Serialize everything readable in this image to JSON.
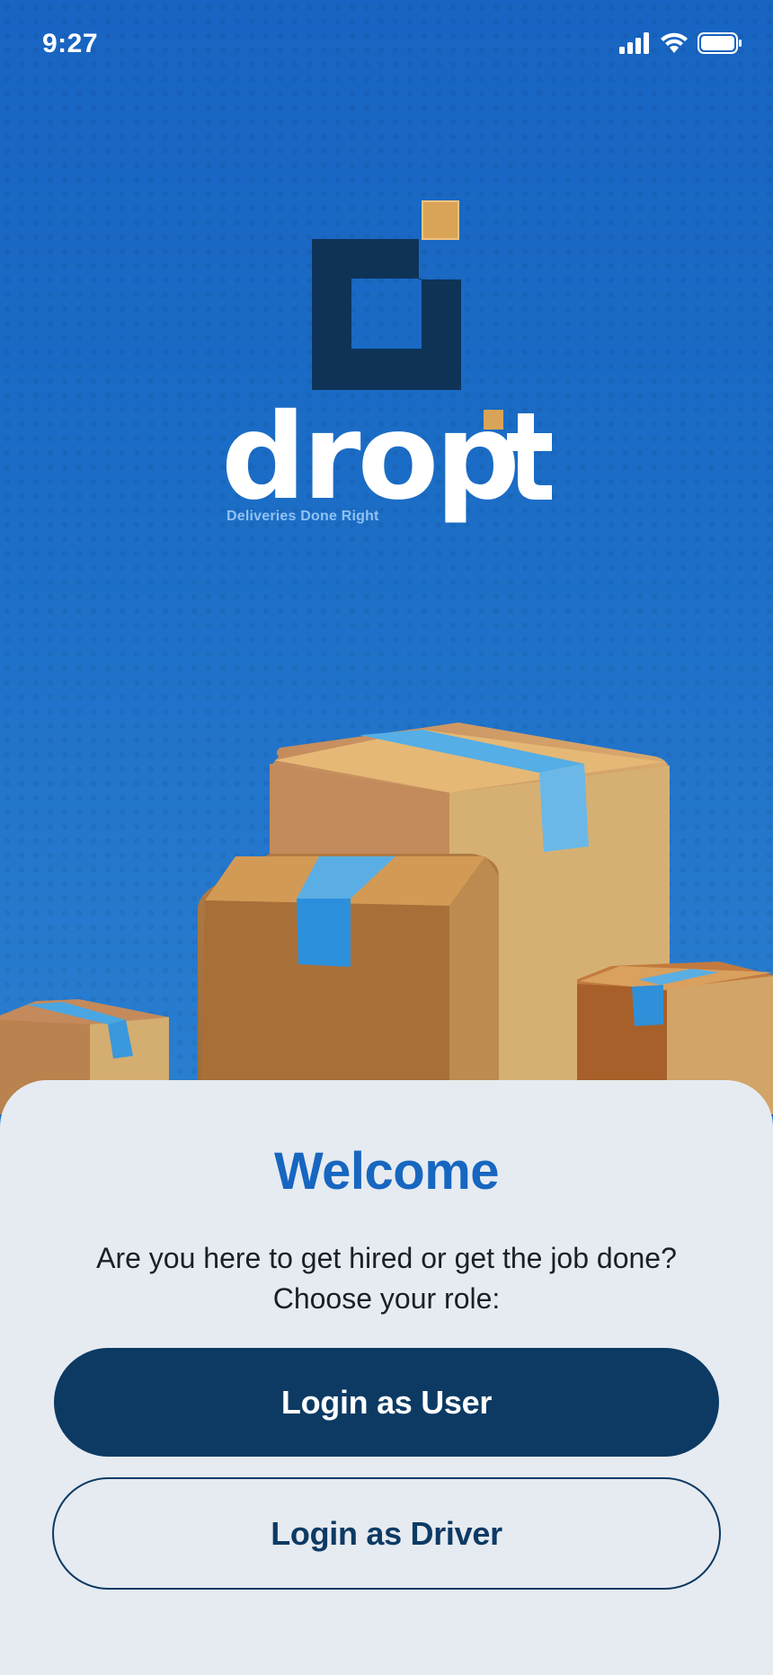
{
  "status_bar": {
    "time": "9:27",
    "icons": [
      "signal-icon",
      "wifi-icon",
      "battery-icon"
    ]
  },
  "brand": {
    "name": "drop it",
    "tagline": "Deliveries Done Right",
    "colors": {
      "navy": "#0c3a63",
      "accent": "#d9a457",
      "blue": "#1766c0"
    }
  },
  "welcome": {
    "title": "Welcome",
    "subtitle_line1": "Are you here to get hired or get the job done?",
    "subtitle_line2": "Choose your role:"
  },
  "actions": {
    "user_label": "Login as User",
    "driver_label": "Login as Driver"
  }
}
